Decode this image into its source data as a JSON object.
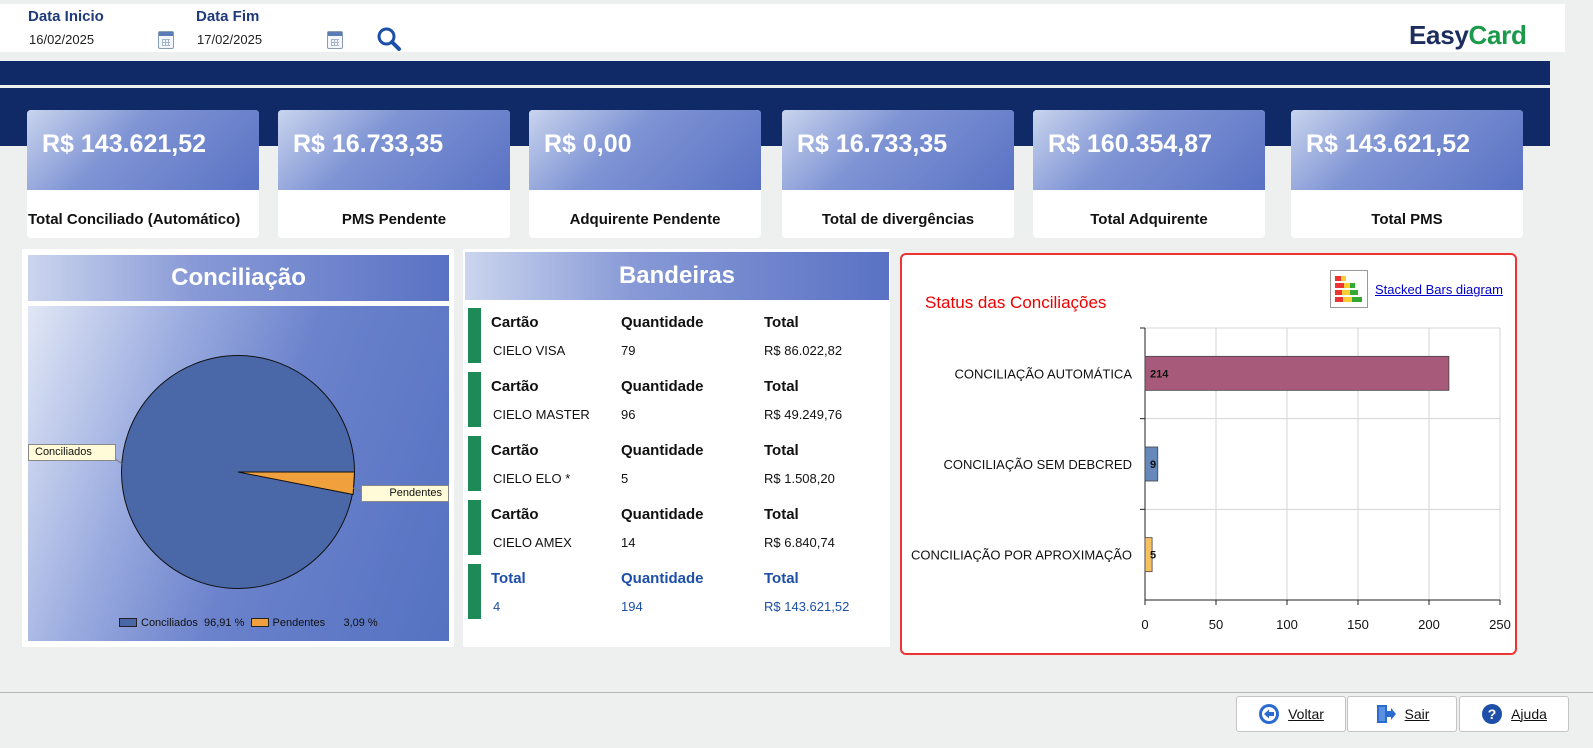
{
  "filters": {
    "start_label": "Data Inicio",
    "start_value": "16/02/2025",
    "end_label": "Data Fim",
    "end_value": "17/02/2025"
  },
  "logo": {
    "part1": "Easy",
    "part2": "Card"
  },
  "kpis": [
    {
      "value": "R$ 143.621,52",
      "caption": "Total Conciliado (Automático)"
    },
    {
      "value": "R$ 16.733,35",
      "caption": "PMS Pendente"
    },
    {
      "value": "R$ 0,00",
      "caption": "Adquirente Pendente"
    },
    {
      "value": "R$ 16.733,35",
      "caption": "Total de divergências"
    },
    {
      "value": "R$ 160.354,87",
      "caption": "Total Adquirente"
    },
    {
      "value": "R$ 143.621,52",
      "caption": "Total PMS"
    }
  ],
  "conciliacao": {
    "title": "Conciliação",
    "callout_a": "Conciliados",
    "callout_b": "Pendentes",
    "legend": [
      {
        "label": "Conciliados",
        "pct": "96,91 %",
        "color": "#4a68a8"
      },
      {
        "label": "Pendentes",
        "pct": "3,09 %",
        "color": "#f0a03c"
      }
    ]
  },
  "bandeiras": {
    "title": "Bandeiras",
    "rows": [
      {
        "h1": "Cartão",
        "h2": "Quantidade",
        "h3": "Total",
        "name": "CIELO VISA",
        "qty": "79",
        "total": "R$ 86.022,82"
      },
      {
        "h1": "Cartão",
        "h2": "Quantidade",
        "h3": "Total",
        "name": "CIELO MASTER",
        "qty": "96",
        "total": "R$ 49.249,76"
      },
      {
        "h1": "Cartão",
        "h2": "Quantidade",
        "h3": "Total",
        "name": "CIELO ELO *",
        "qty": "5",
        "total": "R$ 1.508,20"
      },
      {
        "h1": "Cartão",
        "h2": "Quantidade",
        "h3": "Total",
        "name": "CIELO AMEX",
        "qty": "14",
        "total": "R$ 6.840,74"
      }
    ],
    "total": {
      "h1": "Total",
      "h2": "Quantidade",
      "h3": "Total",
      "name": "4",
      "qty": "194",
      "total": "R$ 143.621,52"
    }
  },
  "status_chart": {
    "title": "Status das Conciliações",
    "link": "Stacked Bars diagram"
  },
  "chart_data": {
    "type": "bar",
    "orientation": "horizontal",
    "categories": [
      "CONCILIAÇÃO AUTOMÁTICA",
      "CONCILIAÇÃO SEM DEBCRED",
      "CONCILIAÇÃO POR APROXIMAÇÃO"
    ],
    "values": [
      214,
      9,
      5
    ],
    "colors": [
      "#a85a7a",
      "#6688bb",
      "#f5c060"
    ],
    "data_labels": [
      "214",
      "9",
      "5"
    ],
    "xlim": [
      0,
      250
    ],
    "xticks": [
      "0",
      "50",
      "100",
      "150",
      "200",
      "250"
    ],
    "grid": true,
    "title": "Status das Conciliações"
  },
  "buttons": {
    "back": "Voltar",
    "exit": "Sair",
    "help": "Ajuda"
  }
}
